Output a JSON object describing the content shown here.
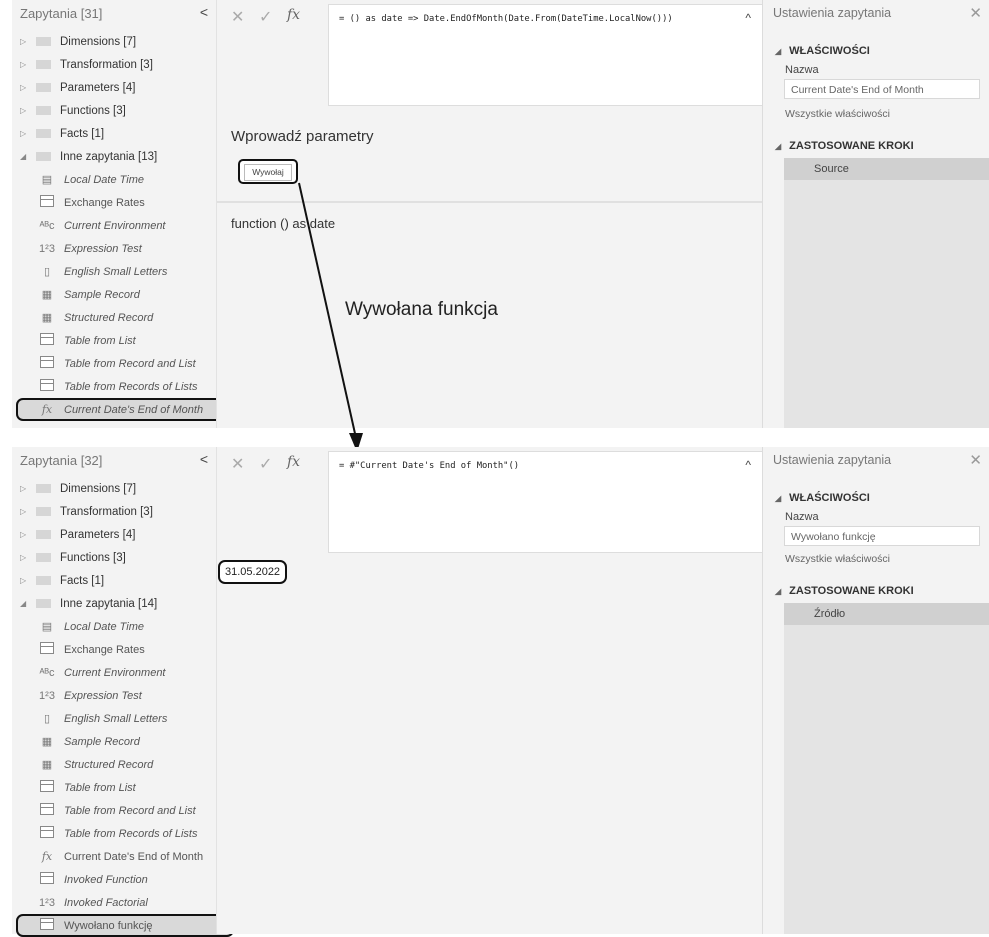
{
  "top": {
    "queries_header": "Zapytania [31]",
    "collapse_glyph": "<",
    "groups": [
      {
        "label": "Dimensions [7]"
      },
      {
        "label": "Transformation [3]"
      },
      {
        "label": "Parameters [4]"
      },
      {
        "label": "Functions [3]"
      },
      {
        "label": "Facts [1]"
      },
      {
        "label": "Inne zapytania [13]"
      }
    ],
    "items": [
      {
        "label": "Local Date Time",
        "icon": "calendar-clock-icon"
      },
      {
        "label": "Exchange Rates",
        "icon": "table-icon"
      },
      {
        "label": "Current Environment",
        "icon": "text-type-icon"
      },
      {
        "label": "Expression Test",
        "icon": "number-type-icon"
      },
      {
        "label": "English Small Letters",
        "icon": "list-icon"
      },
      {
        "label": "Sample Record",
        "icon": "record-icon"
      },
      {
        "label": "Structured Record",
        "icon": "record-icon"
      },
      {
        "label": "Table from List",
        "icon": "table-icon"
      },
      {
        "label": "Table from Record and List",
        "icon": "table-icon"
      },
      {
        "label": "Table from Records of Lists",
        "icon": "table-icon"
      },
      {
        "label": "Current Date's End of Month",
        "icon": "function-icon"
      }
    ],
    "formula": "= () as date => Date.EndOfMonth(Date.From(DateTime.LocalNow()))",
    "enter_params": "Wprowadź parametry",
    "invoke_button": "Wywołaj",
    "function_sig": "function () as date",
    "settings_title": "Ustawienia zapytania",
    "properties_header": "WŁAŚCIWOŚCI",
    "name_label": "Nazwa",
    "name_value": "Current Date's End of Month",
    "all_properties": "Wszystkie właściwości",
    "steps_header": "ZASTOSOWANE KROKI",
    "steps": [
      "Source"
    ]
  },
  "annotation": {
    "label": "Wywołana funkcja"
  },
  "bottom": {
    "queries_header": "Zapytania [32]",
    "collapse_glyph": "<",
    "groups": [
      {
        "label": "Dimensions [7]"
      },
      {
        "label": "Transformation [3]"
      },
      {
        "label": "Parameters [4]"
      },
      {
        "label": "Functions [3]"
      },
      {
        "label": "Facts [1]"
      },
      {
        "label": "Inne zapytania [14]"
      }
    ],
    "items": [
      {
        "label": "Local Date Time",
        "icon": "calendar-clock-icon"
      },
      {
        "label": "Exchange Rates",
        "icon": "table-icon"
      },
      {
        "label": "Current Environment",
        "icon": "text-type-icon"
      },
      {
        "label": "Expression Test",
        "icon": "number-type-icon"
      },
      {
        "label": "English Small Letters",
        "icon": "list-icon"
      },
      {
        "label": "Sample Record",
        "icon": "record-icon"
      },
      {
        "label": "Structured Record",
        "icon": "record-icon"
      },
      {
        "label": "Table from List",
        "icon": "table-icon"
      },
      {
        "label": "Table from Record and List",
        "icon": "table-icon"
      },
      {
        "label": "Table from Records of Lists",
        "icon": "table-icon"
      },
      {
        "label": "Current Date's End of Month",
        "icon": "function-icon"
      },
      {
        "label": "Invoked Function",
        "icon": "table-icon"
      },
      {
        "label": "Invoked Factorial",
        "icon": "number-type-icon"
      },
      {
        "label": "Wywołano funkcję",
        "icon": "table-icon"
      }
    ],
    "formula": "= #\"Current Date's End of Month\"()",
    "result_value": "31.05.2022",
    "settings_title": "Ustawienia zapytania",
    "properties_header": "WŁAŚCIWOŚCI",
    "name_label": "Nazwa",
    "name_value": "Wywołano funkcję",
    "all_properties": "Wszystkie właściwości",
    "steps_header": "ZASTOSOWANE KROKI",
    "steps": [
      "Źródło"
    ]
  }
}
